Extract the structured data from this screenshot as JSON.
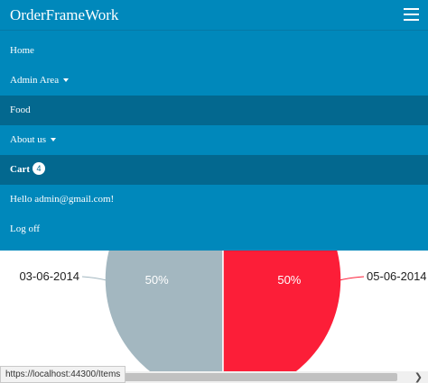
{
  "app": {
    "brand": "OrderFrameWork"
  },
  "nav": {
    "items": [
      {
        "label": "Home"
      },
      {
        "label": "Admin Area"
      },
      {
        "label": "Food"
      },
      {
        "label": "About us"
      },
      {
        "label": "Cart",
        "badge": "4"
      },
      {
        "label": "Hello admin@gmail.com!"
      },
      {
        "label": "Log off"
      }
    ]
  },
  "status_bar": {
    "url": "https://localhost:44300/Items"
  },
  "colors": {
    "navbar": "#0088bb",
    "nav_active": "#03688f"
  },
  "chart_data": {
    "type": "pie",
    "slices": [
      {
        "label": "03-06-2014",
        "value": 50,
        "display": "50%",
        "color": "#a3b7c0"
      },
      {
        "label": "05-06-2014",
        "value": 50,
        "display": "50%",
        "color": "#fc1e38"
      }
    ]
  }
}
